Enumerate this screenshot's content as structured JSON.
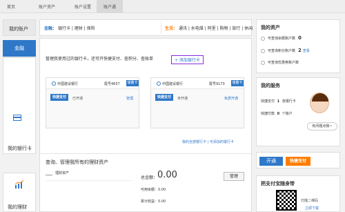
{
  "topnav": {
    "items": [
      "首页",
      "账户资产",
      "账户设置",
      "账户通"
    ]
  },
  "left": {
    "my_account": "我的账户",
    "finance_tab": "金融",
    "bank_card": "我的银行卡",
    "wealth": "我的理财"
  },
  "catbar": {
    "finance_label": "金融：",
    "finance_items": "银行卡 | 理财 | 保险",
    "life_label": "生活：",
    "life_items": "通讯 | 水电煤 | 阿里 | 购物 | 旅行 | 休闲"
  },
  "main": {
    "desc": "管理我使用过的银行卡，还可开快捷支付、查积分、查账单",
    "add_card": "+ 添加银行卡",
    "cards": [
      {
        "bank": "中国建设银行",
        "tail": "尾号4657",
        "badge": "储蓄卡",
        "kjt": "快捷支付",
        "status": "已开通",
        "action": "管理"
      },
      {
        "bank": "中国建设银行",
        "tail": "尾号9173",
        "badge": "储蓄卡",
        "kjt": "快捷支付",
        "status": "未开通",
        "action": "免费开通"
      }
    ],
    "card_links": "我的全部银行卡 | 可添加的银行卡",
    "wealth_head": "查询、管理我所有的理财资产",
    "wealth_item": "理财资产",
    "total_label": "总金额：",
    "total_value": "0.00",
    "manage": "管理",
    "avail": "可用余额：0.00",
    "accum": "累计收益：0.00"
  },
  "right": {
    "assets_title": "我的资产",
    "asset1": "可查询余额账户数",
    "asset1_num": "0",
    "asset2": "可查询积分账户数",
    "asset2_num": "2",
    "asset2_link": "查看",
    "asset3": "可查询优惠券账户数",
    "services_title": "我的服务",
    "svc1_label": "快捷支付",
    "svc1_num": "1",
    "svc1_unit": "张银行卡",
    "svc2_label": "快捷付款",
    "svc2_num": "0",
    "svc2_unit": "个账户",
    "help": "有问题点我~",
    "kjt_open": "开通",
    "kjt_logo": "快捷支付",
    "qr_title": "把支付宝随身带",
    "qr_hint": "扫描二维码",
    "qr_dl": "立即下载"
  }
}
